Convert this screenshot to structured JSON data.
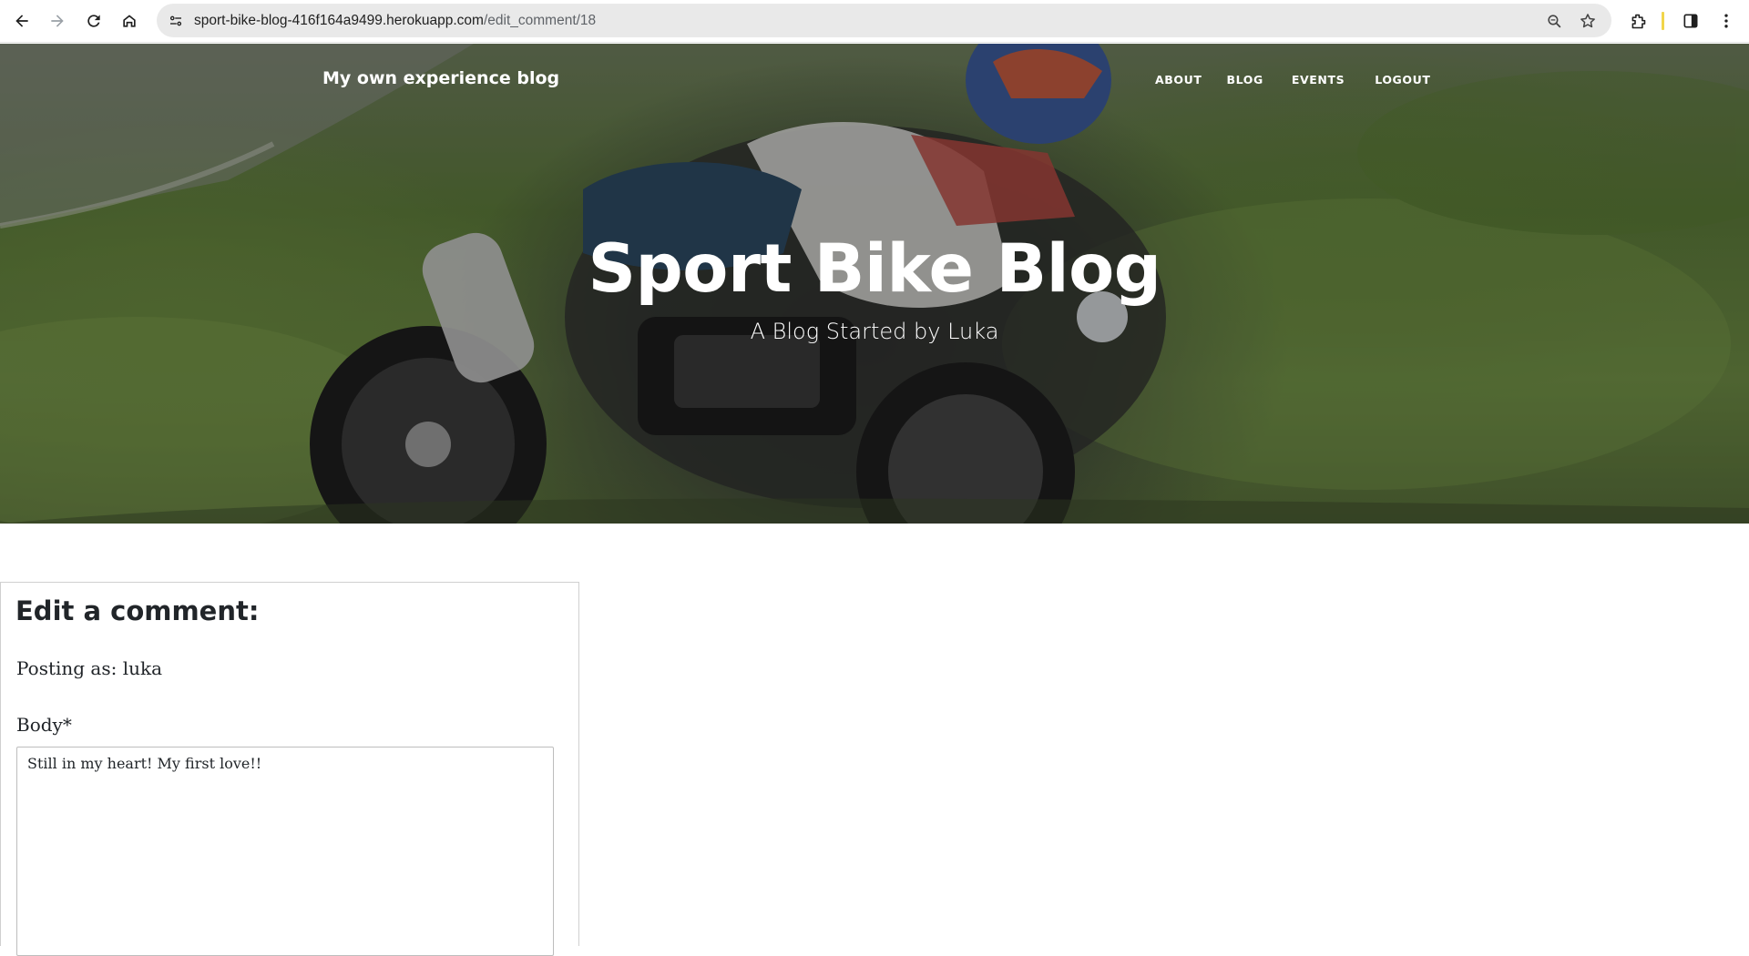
{
  "browser": {
    "url_host": "sport-bike-blog-416f164a9499.herokuapp.com",
    "url_path": "/edit_comment/18",
    "icons": [
      "back-icon",
      "forward-icon",
      "reload-icon",
      "home-icon",
      "site-info-icon",
      "zoom-icon",
      "bookmark-star-icon",
      "extensions-icon",
      "side-panel-icon",
      "menu-icon"
    ]
  },
  "header": {
    "brand": "My own experience blog",
    "nav": [
      {
        "label": "ABOUT"
      },
      {
        "label": "BLOG"
      },
      {
        "label": "EVENTS"
      },
      {
        "label": "LOGOUT"
      }
    ],
    "title": "Sport Bike Blog",
    "subtitle": "A Blog Started by Luka"
  },
  "form": {
    "heading": "Edit a comment:",
    "posting_as": "Posting as: luka",
    "body_label": "Body*",
    "body_value": "Still in my heart! My first love!!"
  },
  "colors": {
    "text_dark": "#212529",
    "omnibox_bg": "#e9e9e9"
  }
}
